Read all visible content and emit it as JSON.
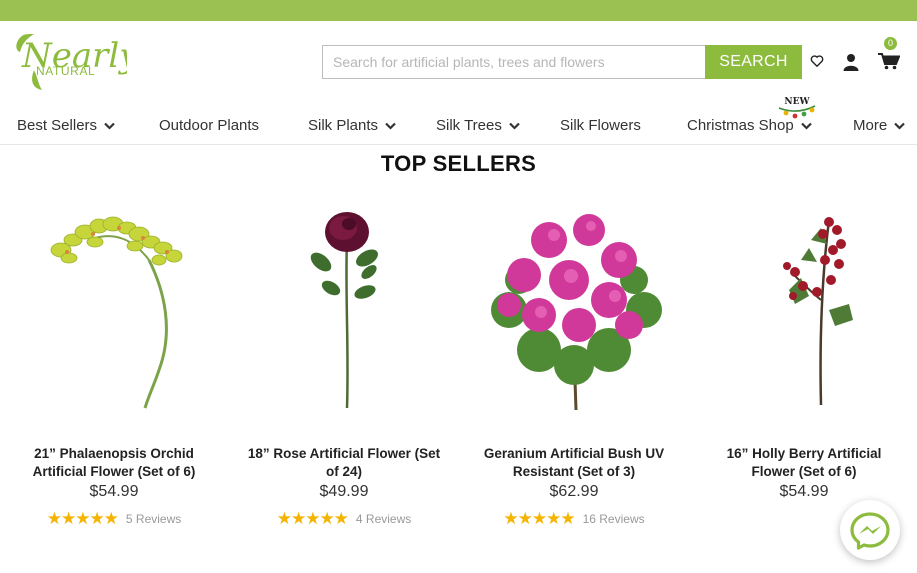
{
  "brand": {
    "logo_line1": "Nearly",
    "logo_line2": "NATURAL",
    "accent": "#8dbb3e",
    "topbar": "#9bc153"
  },
  "header": {
    "search_placeholder": "Search for artificial plants, trees and flowers",
    "search_button": "SEARCH",
    "cart_count": "0",
    "icons": [
      "heart-icon",
      "user-icon",
      "cart-icon"
    ]
  },
  "nav": {
    "items": [
      {
        "label": "Best Sellers",
        "dropdown": true
      },
      {
        "label": "Outdoor Plants",
        "dropdown": false
      },
      {
        "label": "Silk Plants",
        "dropdown": true
      },
      {
        "label": "Silk Trees",
        "dropdown": true
      },
      {
        "label": "Silk Flowers",
        "dropdown": false
      },
      {
        "label": "Christmas Shop",
        "dropdown": true
      },
      {
        "label": "More",
        "dropdown": true
      }
    ],
    "new_badge": "NEW"
  },
  "section": {
    "title": "TOP SELLERS"
  },
  "products": [
    {
      "name": "21” Phalaenopsis Orchid Artificial Flower (Set of 6)",
      "price": "$54.99",
      "rating": 5,
      "reviews": "5 Reviews",
      "image": "orchid-image"
    },
    {
      "name": "18” Rose Artificial Flower (Set of 24)",
      "price": "$49.99",
      "rating": 5,
      "reviews": "4 Reviews",
      "image": "rose-image"
    },
    {
      "name": "Geranium Artificial Bush UV Resistant (Set of 3)",
      "price": "$62.99",
      "rating": 5,
      "reviews": "16 Reviews",
      "image": "geranium-image"
    },
    {
      "name": "16” Holly Berry Artificial Flower (Set of 6)",
      "price": "$54.99",
      "rating": null,
      "reviews": "",
      "image": "holly-berry-image"
    }
  ],
  "stars_text": "★★★★★",
  "chat": {
    "icon": "messenger-icon"
  }
}
